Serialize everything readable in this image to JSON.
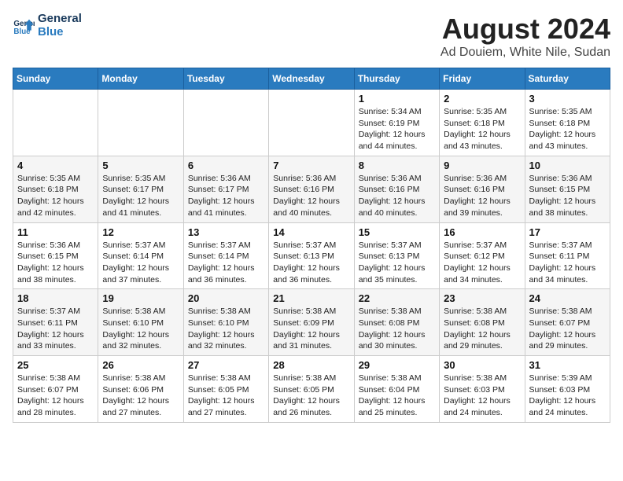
{
  "logo": {
    "line1": "General",
    "line2": "Blue"
  },
  "title": "August 2024",
  "location": "Ad Douiem, White Nile, Sudan",
  "days_header": [
    "Sunday",
    "Monday",
    "Tuesday",
    "Wednesday",
    "Thursday",
    "Friday",
    "Saturday"
  ],
  "weeks": [
    [
      {
        "day": "",
        "text": ""
      },
      {
        "day": "",
        "text": ""
      },
      {
        "day": "",
        "text": ""
      },
      {
        "day": "",
        "text": ""
      },
      {
        "day": "1",
        "text": "Sunrise: 5:34 AM\nSunset: 6:19 PM\nDaylight: 12 hours\nand 44 minutes."
      },
      {
        "day": "2",
        "text": "Sunrise: 5:35 AM\nSunset: 6:18 PM\nDaylight: 12 hours\nand 43 minutes."
      },
      {
        "day": "3",
        "text": "Sunrise: 5:35 AM\nSunset: 6:18 PM\nDaylight: 12 hours\nand 43 minutes."
      }
    ],
    [
      {
        "day": "4",
        "text": "Sunrise: 5:35 AM\nSunset: 6:18 PM\nDaylight: 12 hours\nand 42 minutes."
      },
      {
        "day": "5",
        "text": "Sunrise: 5:35 AM\nSunset: 6:17 PM\nDaylight: 12 hours\nand 41 minutes."
      },
      {
        "day": "6",
        "text": "Sunrise: 5:36 AM\nSunset: 6:17 PM\nDaylight: 12 hours\nand 41 minutes."
      },
      {
        "day": "7",
        "text": "Sunrise: 5:36 AM\nSunset: 6:16 PM\nDaylight: 12 hours\nand 40 minutes."
      },
      {
        "day": "8",
        "text": "Sunrise: 5:36 AM\nSunset: 6:16 PM\nDaylight: 12 hours\nand 40 minutes."
      },
      {
        "day": "9",
        "text": "Sunrise: 5:36 AM\nSunset: 6:16 PM\nDaylight: 12 hours\nand 39 minutes."
      },
      {
        "day": "10",
        "text": "Sunrise: 5:36 AM\nSunset: 6:15 PM\nDaylight: 12 hours\nand 38 minutes."
      }
    ],
    [
      {
        "day": "11",
        "text": "Sunrise: 5:36 AM\nSunset: 6:15 PM\nDaylight: 12 hours\nand 38 minutes."
      },
      {
        "day": "12",
        "text": "Sunrise: 5:37 AM\nSunset: 6:14 PM\nDaylight: 12 hours\nand 37 minutes."
      },
      {
        "day": "13",
        "text": "Sunrise: 5:37 AM\nSunset: 6:14 PM\nDaylight: 12 hours\nand 36 minutes."
      },
      {
        "day": "14",
        "text": "Sunrise: 5:37 AM\nSunset: 6:13 PM\nDaylight: 12 hours\nand 36 minutes."
      },
      {
        "day": "15",
        "text": "Sunrise: 5:37 AM\nSunset: 6:13 PM\nDaylight: 12 hours\nand 35 minutes."
      },
      {
        "day": "16",
        "text": "Sunrise: 5:37 AM\nSunset: 6:12 PM\nDaylight: 12 hours\nand 34 minutes."
      },
      {
        "day": "17",
        "text": "Sunrise: 5:37 AM\nSunset: 6:11 PM\nDaylight: 12 hours\nand 34 minutes."
      }
    ],
    [
      {
        "day": "18",
        "text": "Sunrise: 5:37 AM\nSunset: 6:11 PM\nDaylight: 12 hours\nand 33 minutes."
      },
      {
        "day": "19",
        "text": "Sunrise: 5:38 AM\nSunset: 6:10 PM\nDaylight: 12 hours\nand 32 minutes."
      },
      {
        "day": "20",
        "text": "Sunrise: 5:38 AM\nSunset: 6:10 PM\nDaylight: 12 hours\nand 32 minutes."
      },
      {
        "day": "21",
        "text": "Sunrise: 5:38 AM\nSunset: 6:09 PM\nDaylight: 12 hours\nand 31 minutes."
      },
      {
        "day": "22",
        "text": "Sunrise: 5:38 AM\nSunset: 6:08 PM\nDaylight: 12 hours\nand 30 minutes."
      },
      {
        "day": "23",
        "text": "Sunrise: 5:38 AM\nSunset: 6:08 PM\nDaylight: 12 hours\nand 29 minutes."
      },
      {
        "day": "24",
        "text": "Sunrise: 5:38 AM\nSunset: 6:07 PM\nDaylight: 12 hours\nand 29 minutes."
      }
    ],
    [
      {
        "day": "25",
        "text": "Sunrise: 5:38 AM\nSunset: 6:07 PM\nDaylight: 12 hours\nand 28 minutes."
      },
      {
        "day": "26",
        "text": "Sunrise: 5:38 AM\nSunset: 6:06 PM\nDaylight: 12 hours\nand 27 minutes."
      },
      {
        "day": "27",
        "text": "Sunrise: 5:38 AM\nSunset: 6:05 PM\nDaylight: 12 hours\nand 27 minutes."
      },
      {
        "day": "28",
        "text": "Sunrise: 5:38 AM\nSunset: 6:05 PM\nDaylight: 12 hours\nand 26 minutes."
      },
      {
        "day": "29",
        "text": "Sunrise: 5:38 AM\nSunset: 6:04 PM\nDaylight: 12 hours\nand 25 minutes."
      },
      {
        "day": "30",
        "text": "Sunrise: 5:38 AM\nSunset: 6:03 PM\nDaylight: 12 hours\nand 24 minutes."
      },
      {
        "day": "31",
        "text": "Sunrise: 5:39 AM\nSunset: 6:03 PM\nDaylight: 12 hours\nand 24 minutes."
      }
    ]
  ]
}
